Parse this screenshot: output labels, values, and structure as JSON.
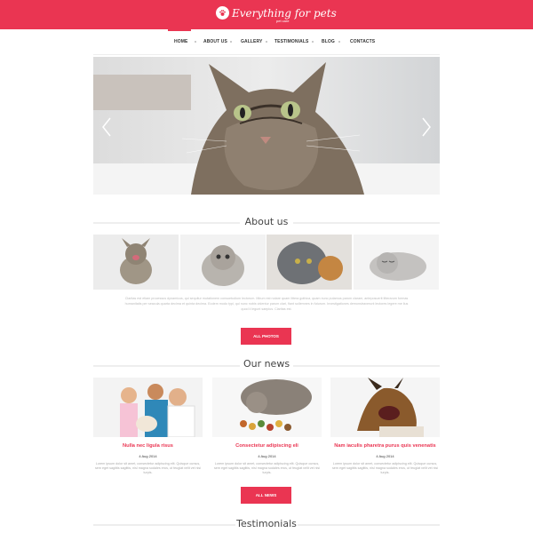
{
  "brand": {
    "title": "Everything for pets",
    "subtitle": "pet care",
    "accent_color": "#ea3552"
  },
  "nav": {
    "items": [
      {
        "label": "HOME",
        "active": true
      },
      {
        "label": "ABOUT US"
      },
      {
        "label": "GALLERY"
      },
      {
        "label": "TESTIMONIALS"
      },
      {
        "label": "BLOG"
      },
      {
        "label": "CONTACTS"
      }
    ]
  },
  "hero": {
    "image": "tabby-cat-photo",
    "prev_icon": "chevron-left-icon",
    "next_icon": "chevron-right-icon"
  },
  "about": {
    "title": "About us",
    "photos": [
      "kitten-yawning-photo",
      "fluffy-kitten-photo",
      "gray-cat-with-ball-photo",
      "sleeping-kitten-photo"
    ],
    "text": "Claritas est etiam processus dynamicus, qui sequitur mutationem consuetudium lectorum. Mirum est notare quam littera gothica, quam nunc putamus parum claram, anteposuerit litterarum formas humanitatis per seacula quarta decima et quinta decima. Eodem modo typi, qui nunc nobis videntur parum clari, fiant sollemnes in futurum. Investigationes demonstraverunt lectores legere me lius quod ii legunt saepius. Claritas est.",
    "button": "ALL PHOTOS"
  },
  "news": {
    "title": "Our news",
    "items": [
      {
        "image": "family-with-puppy-photo",
        "title": "Nulla nec ligula risus",
        "date": "4 Aug 2014",
        "text": "Lorem ipsum dolor sit amet, consectetur adipiscing elit. Quisque cursus, sem eget sagittis sagittis, nisl magna sodales eros, ut feugiat velit vel nisi turpis."
      },
      {
        "image": "cat-eating-food-photo",
        "title": "Consectetur adipiscing eli",
        "date": "4 Aug 2014",
        "text": "Lorem ipsum dolor sit amet, consectetur adipiscing elit. Quisque cursus, sem eget sagittis sagittis, nisl magna sodales eros, ut feugiat velit vel nisi turpis."
      },
      {
        "image": "barking-dog-photo",
        "title": "Nam iaculis pharetra purus quis venenatis",
        "date": "4 Aug 2014",
        "text": "Lorem ipsum dolor sit amet, consectetur adipiscing elit. Quisque cursus, sem eget sagittis sagittis, nisl magna sodales eros, ut feugiat velit vel nisi turpis."
      }
    ],
    "button": "ALL NEWS"
  },
  "testimonials": {
    "title": "Testimonials"
  }
}
